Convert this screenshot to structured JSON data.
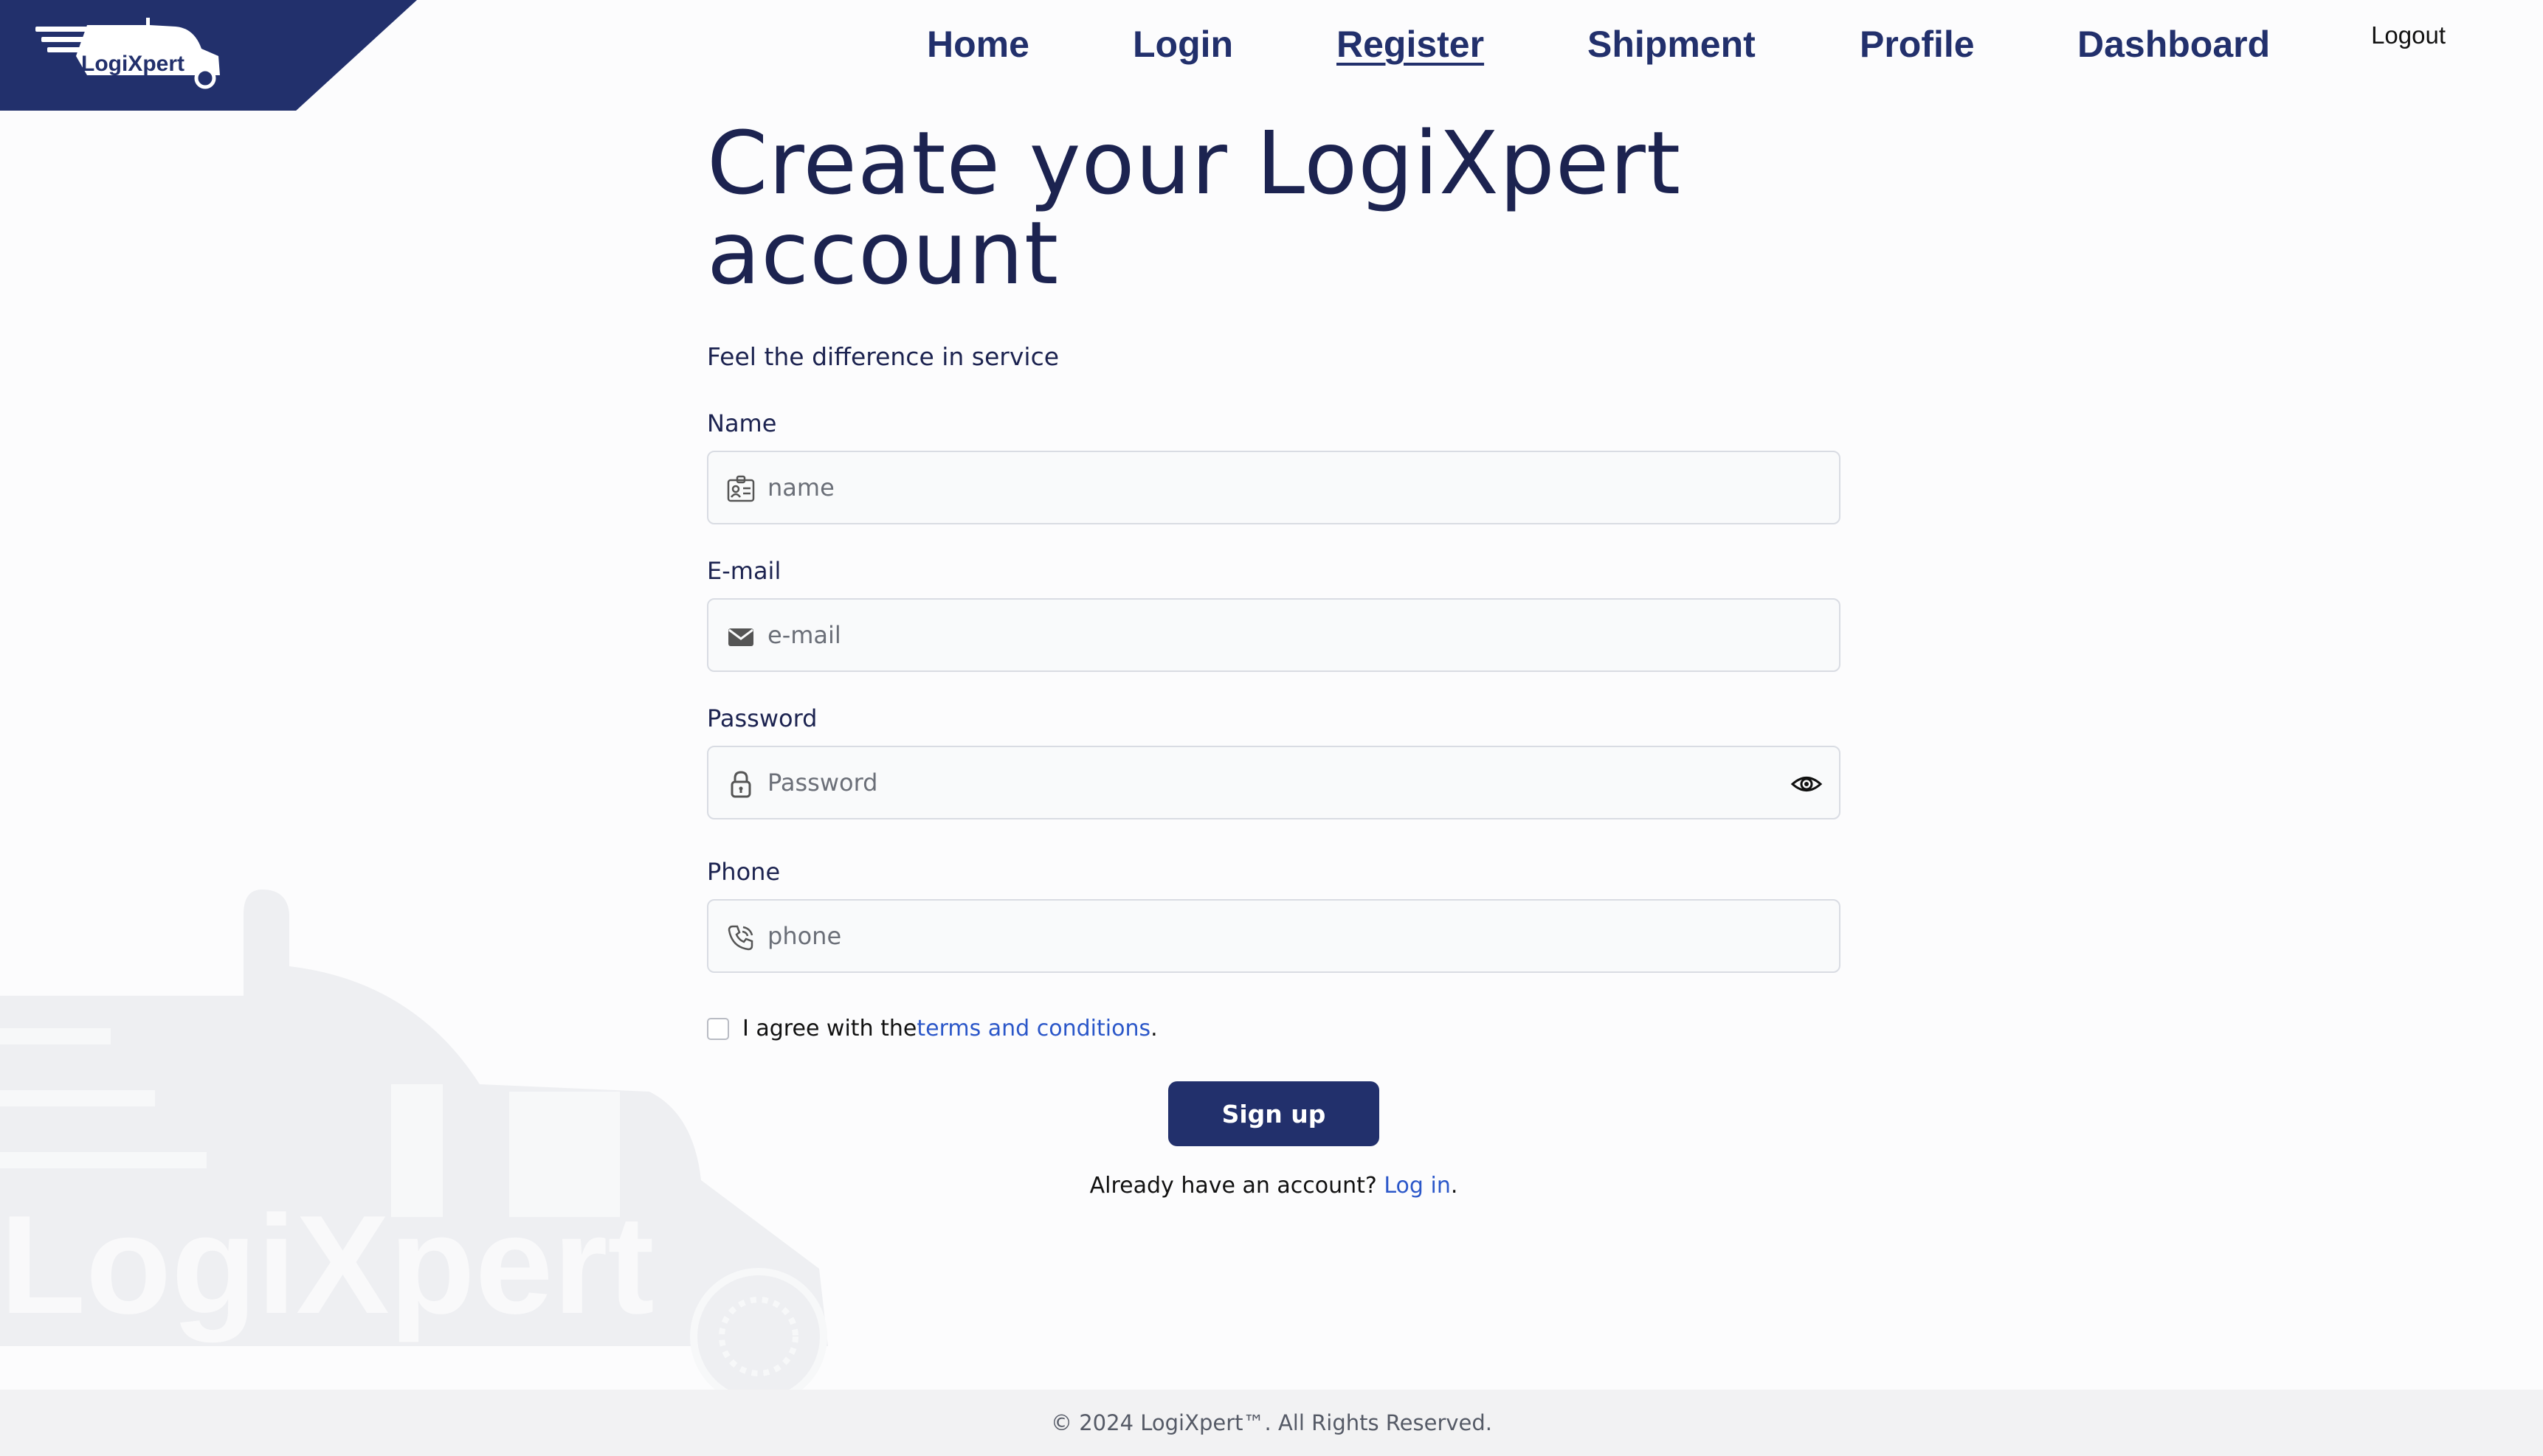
{
  "brand": {
    "name": "LogiXpert",
    "primary_color": "#22306c",
    "link_color": "#2b57c9"
  },
  "nav": {
    "items": [
      {
        "label": "Home"
      },
      {
        "label": "Login"
      },
      {
        "label": "Register",
        "active": true
      },
      {
        "label": "Shipment"
      },
      {
        "label": "Profile"
      },
      {
        "label": "Dashboard"
      }
    ],
    "logout_label": "Logout"
  },
  "form": {
    "title": "Create your LogiXpert account",
    "subtitle": "Feel the difference in service",
    "fields": {
      "name": {
        "label": "Name",
        "placeholder": "name",
        "icon": "id-card-icon"
      },
      "email": {
        "label": "E-mail",
        "placeholder": "e-mail",
        "icon": "envelope-icon"
      },
      "password": {
        "label": "Password",
        "placeholder": "Password",
        "icon": "lock-icon",
        "toggle_icon": "eye-icon"
      },
      "phone": {
        "label": "Phone",
        "placeholder": "phone",
        "icon": "phone-icon"
      }
    },
    "terms": {
      "prefix": "I agree with the ",
      "link": "terms and conditions",
      "suffix": ".",
      "checked": false
    },
    "signup_label": "Sign up",
    "login_prompt": {
      "prefix": "Already have an account? ",
      "link": "Log in",
      "suffix": "."
    }
  },
  "watermark": {
    "text": "LogiXpert"
  },
  "footer": {
    "copyright": "© 2024 LogiXpert™. All Rights Reserved."
  }
}
